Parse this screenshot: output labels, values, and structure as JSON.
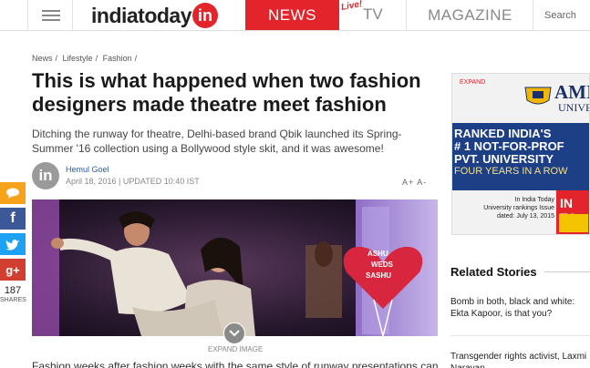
{
  "header": {
    "logo_text": "indiatoday",
    "logo_badge": "in",
    "nav_news": "NEWS",
    "nav_live": "Live!",
    "nav_tv": "TV",
    "nav_magazine": "MAGAZINE",
    "search_label": "Search"
  },
  "breadcrumb": {
    "items": [
      "News",
      "Lifestyle",
      "Fashion"
    ],
    "separator": "/"
  },
  "article": {
    "headline": "This is what happened when two fashion designers made theatre meet fashion",
    "dek": "Ditching the runway for theatre, Delhi-based brand Qbik launched its Spring-Summer '16 collection using a Bollywood style skit, and it was awesome!",
    "author_badge": "in",
    "author": "Hemul Goel",
    "dateline": "April 18, 2016 | UPDATED 10:40 IST",
    "font_controls": "A+ A-",
    "expand_image": "EXPAND IMAGE",
    "body_start": "Fashion weeks after fashion weeks with the same style of runway presentations can get",
    "image_sign_text": [
      "ASHU",
      "WEDS",
      "SASHU"
    ]
  },
  "share": {
    "count": "187",
    "label": "SHARES",
    "google_plus": "g+",
    "facebook": "f"
  },
  "ad": {
    "expand": "EXPAND",
    "brand": "AMI",
    "brand_sub": "UNIVE",
    "line1": "RANKED INDIA'S",
    "line2": "# 1 NOT-FOR-PROF",
    "line3": "PVT. UNIVERSITY",
    "line4": "FOUR YEARS IN A ROW",
    "footer": [
      "In India Today",
      "University rankings Issue",
      "dated: July 13, 2015"
    ],
    "mag_text": "IN TO"
  },
  "related": {
    "title": "Related Stories",
    "items": [
      "Bomb in both, black and white: Ekta Kapoor, is that you?",
      "Transgender rights activist, Laxmi Narayan..."
    ]
  },
  "colors": {
    "brand_red": "#e3242b",
    "facebook": "#3b5998",
    "twitter": "#1da1f2",
    "google_plus": "#d23f31",
    "comment": "#f7a21b",
    "ad_blue": "#1d3f85"
  }
}
